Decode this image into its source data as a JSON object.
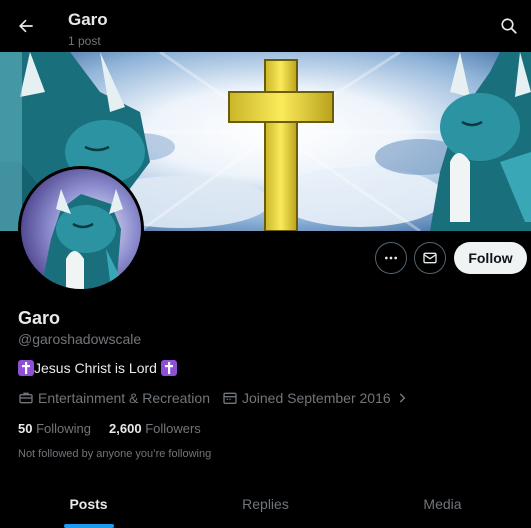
{
  "header": {
    "title": "Garo",
    "post_count": "1 post",
    "back_icon": "arrow-left-icon",
    "search_icon": "search-icon"
  },
  "profile": {
    "display_name": "Garo",
    "handle": "@garoshadowscale",
    "bio_text": "Jesus Christ is Lord",
    "category": "Entertainment & Recreation",
    "joined": "Joined September 2016",
    "following_count": "50",
    "following_label": "Following",
    "followers_count": "2,600",
    "followers_label": "Followers",
    "followed_note": "Not followed by anyone you’re following"
  },
  "actions": {
    "follow_label": "Follow",
    "more_icon": "more-icon",
    "message_icon": "message-icon"
  },
  "tabs": [
    {
      "label": "Posts",
      "active": true
    },
    {
      "label": "Replies",
      "active": false
    },
    {
      "label": "Media",
      "active": false
    }
  ],
  "colors": {
    "background": "#000000",
    "accent": "#1d9bf0",
    "muted_text": "#71767b",
    "cross_badge": "#8f4fd6",
    "dragon_teal": "#1f7f8c"
  }
}
